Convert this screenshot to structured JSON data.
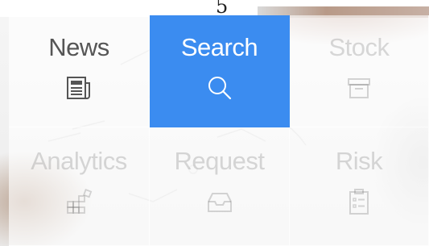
{
  "tiles": [
    {
      "label": "News",
      "icon": "newspaper-icon",
      "state": "default"
    },
    {
      "label": "Search",
      "icon": "search-icon",
      "state": "selected"
    },
    {
      "label": "Stock",
      "icon": "archive-box-icon",
      "state": "faded"
    },
    {
      "label": "Analytics",
      "icon": "blocks-icon",
      "state": "faded"
    },
    {
      "label": "Request",
      "icon": "inbox-tray-icon",
      "state": "faded"
    },
    {
      "label": "Risk",
      "icon": "clipboard-list-icon",
      "state": "faded"
    }
  ],
  "colors": {
    "accent": "#3b8cf0",
    "active_text": "#ffffff",
    "default_text": "#555555",
    "faded_text": "rgba(120,120,120,0.28)"
  },
  "top_mark": "5"
}
